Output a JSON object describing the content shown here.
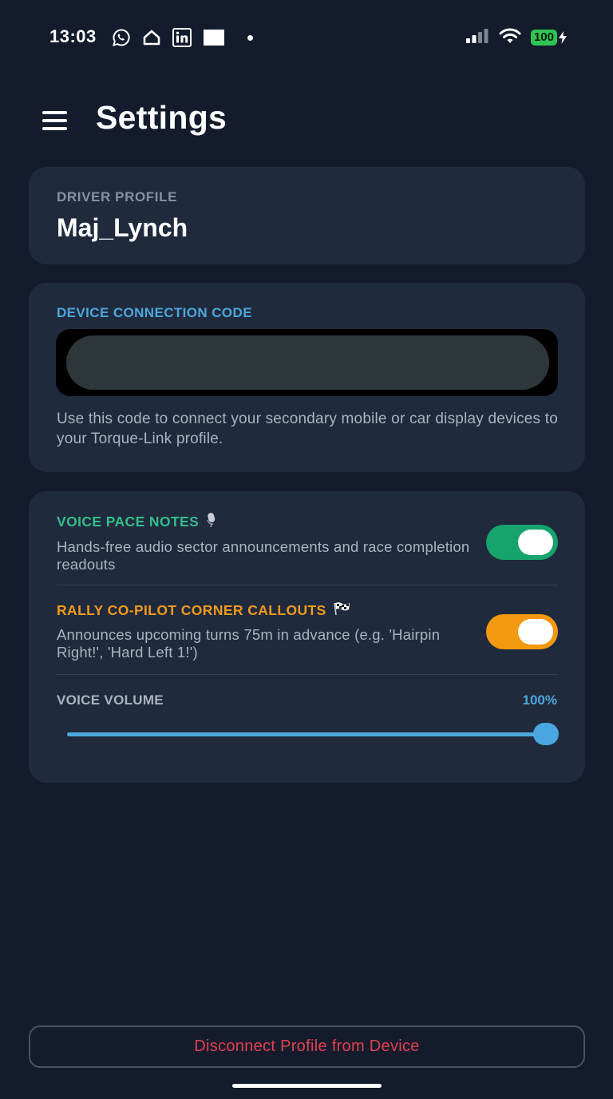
{
  "status_bar": {
    "time": "13:03",
    "battery_level": "100",
    "icons_left": [
      "whatsapp-icon",
      "home-icon",
      "linkedin-icon",
      "white-square-icon",
      "dot-icon"
    ],
    "icons_right": [
      "signal-icon",
      "wifi-icon",
      "battery-icon",
      "charging-icon"
    ]
  },
  "header": {
    "title": "Settings",
    "menu_icon": "hamburger-menu-icon"
  },
  "driver_profile": {
    "label": "DRIVER PROFILE",
    "name": "Maj_Lynch"
  },
  "device_connection": {
    "label": "DEVICE CONNECTION CODE",
    "code_value": "",
    "description": "Use this code to connect your secondary mobile or car display devices to your Torque-Link profile."
  },
  "voice_settings": {
    "pace_notes": {
      "title": "VOICE PACE NOTES",
      "icon": "microphone-icon",
      "description": "Hands-free audio sector announcements and race completion readouts",
      "enabled": true,
      "color": "#16a36c"
    },
    "corner_callouts": {
      "title": "RALLY CO-PILOT CORNER CALLOUTS",
      "icon": "checkered-flag-icon",
      "description": "Announces upcoming turns 75m in advance (e.g. 'Hairpin Right!', 'Hard Left 1!')",
      "enabled": true,
      "color": "#f2990f"
    },
    "volume": {
      "label": "VOICE VOLUME",
      "value_text": "100%",
      "value": 100,
      "accent": "#4ea7dc"
    }
  },
  "footer": {
    "disconnect_label": "Disconnect Profile from Device",
    "disconnect_color": "#e0414e"
  }
}
